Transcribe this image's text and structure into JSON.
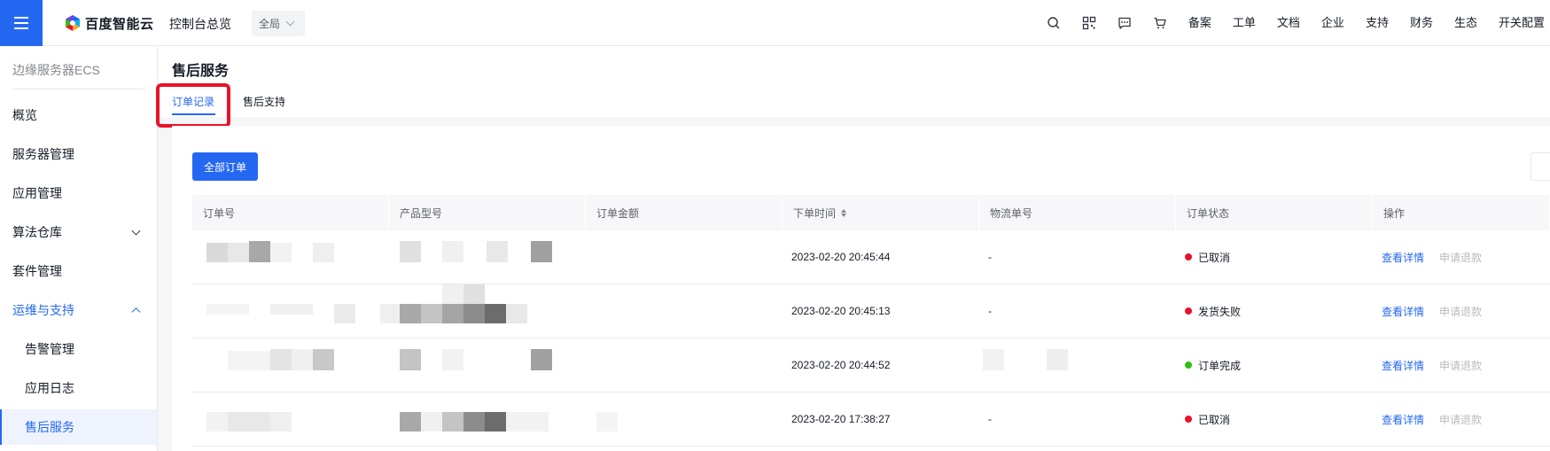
{
  "topbar": {
    "brand_name": "百度智能云",
    "console_label": "控制台总览",
    "region_label": "全局",
    "icons": [
      "search-icon",
      "qrcode-icon",
      "message-icon",
      "cart-icon"
    ],
    "nav_items": [
      "备案",
      "工单",
      "文档",
      "企业",
      "支持",
      "财务",
      "生态",
      "开关配置"
    ],
    "accent_color": "#2468f2"
  },
  "sidebar": {
    "product_title": "边缘服务器ECS",
    "items": [
      {
        "label": "概览"
      },
      {
        "label": "服务器管理"
      },
      {
        "label": "应用管理"
      },
      {
        "label": "算法仓库"
      },
      {
        "label": "套件管理"
      },
      {
        "label": "运维与支持"
      },
      {
        "label": "告警管理"
      },
      {
        "label": "应用日志"
      },
      {
        "label": "售后服务"
      }
    ]
  },
  "page": {
    "title": "售后服务",
    "tabs": [
      {
        "label": "订单记录",
        "active": true
      },
      {
        "label": "售后支持",
        "active": false
      }
    ],
    "all_orders_button": "全部订单"
  },
  "table": {
    "headers": [
      "订单号",
      "产品型号",
      "订单金额",
      "下单时间",
      "物流单号",
      "订单状态",
      "操作"
    ],
    "rows": [
      {
        "time": "2023-02-20 20:45:44",
        "tracking": "-",
        "status": "已取消",
        "status_color": "#e8122a"
      },
      {
        "time": "2023-02-20 20:45:13",
        "tracking": "-",
        "status": "发货失败",
        "status_color": "#e8122a"
      },
      {
        "time": "2023-02-20 20:44:52",
        "tracking": "",
        "status": "订单完成",
        "status_color": "#30bf13"
      },
      {
        "time": "2023-02-20 17:38:27",
        "tracking": "-",
        "status": "已取消",
        "status_color": "#e8122a"
      }
    ],
    "action_view": "查看详情",
    "action_refund": "申请退款"
  }
}
